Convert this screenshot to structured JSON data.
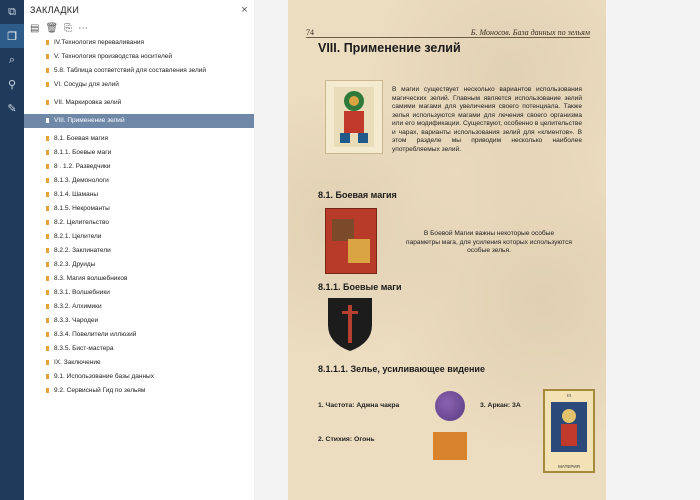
{
  "panel": {
    "title": "ЗАКЛАДКИ",
    "close_icon": "×"
  },
  "bookmarks": [
    "IV.Технология переваливания",
    "V. Технология производства носителей",
    "5.8. Таблица соответствий для составления зелий",
    "VI. Сосуды для зелий",
    "VII. Маркировка зелий",
    "VIII. Применение зелий",
    "8.1. Боевая магия",
    "8.1.1. Боевые маги",
    "8 . 1.2. Разведчики",
    "8.1.3. Демонологи",
    "8.1.4. Шаманы",
    "8.1.5. Некроманты",
    "8.2. Целительство",
    "8.2.1. Целители",
    "8.2.2. Заклинатели",
    "8.2.3. Друиды",
    "8.3. Магия волшебников",
    "8.3.1. Волшебники",
    "8.3.2. Алхимики",
    "8.3.3. Чародеи",
    "8.3.4. Повелители иллюзий",
    "8.3.5. Бист-мастера",
    "IX. Заключение",
    "9.1. Использование базы данных",
    "9.2. Сервисный Гид по зельям"
  ],
  "selected_index": 5,
  "page": {
    "number": "74",
    "running_title": "Б. Моносов. База данных по зельям",
    "heading": "VIII. Применение зелий",
    "intro": "В магии существует несколько вариантов использования магических зелий. Главным является использование зелий самими магами для увеличения своего потенциала. Также зелья используются магами для лечения своего организма или его модификации. Существуют, особенно в целительстве и чарах, варианты использования зелий для «клиентов». В этом разделе мы приводим несколько наиболее употребляемых зелий.",
    "section_1": "8.1. Боевая магия",
    "section_1_text": "В Боевой Магии важны некоторые особые параметры мага, для усиления которых используются особые зелья.",
    "section_2": "8.1.1. Боевые маги",
    "section_3": "8.1.1.1. Зелье, усиливающее видение",
    "freq": "1. Частота: Аджна чакра",
    "arcana": "3. Аркан: 3А",
    "element": "2. Стихия: Огонь",
    "card_num": "III",
    "card_caption": "МАТЕРИЯ"
  }
}
